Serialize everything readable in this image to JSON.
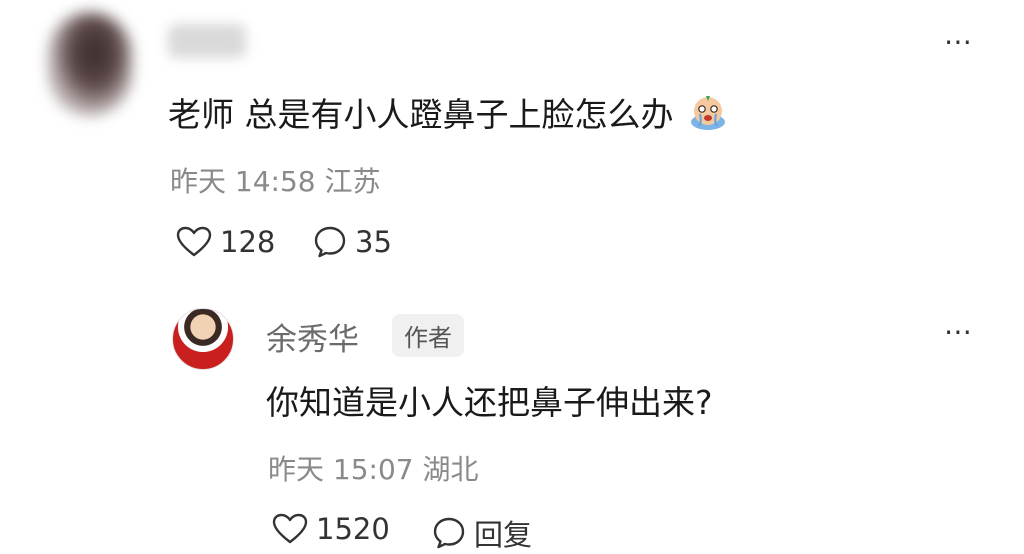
{
  "comment1": {
    "text": "老师 总是有小人蹬鼻子上脸怎么办",
    "meta": "昨天 14:58 江苏",
    "likes": "128",
    "replies": "35",
    "emoji": "crying-face-icon"
  },
  "reply1": {
    "author": "余秀华",
    "badge": "作者",
    "text": "你知道是小人还把鼻子伸出来?",
    "meta": "昨天 15:07 湖北",
    "likes": "1520",
    "reply_label": "回复"
  },
  "icons": {
    "more": "⋯"
  },
  "colors": {
    "text_primary": "#1a1a1a",
    "text_secondary": "#8a8a8a",
    "badge_bg": "#f0f0f0"
  }
}
